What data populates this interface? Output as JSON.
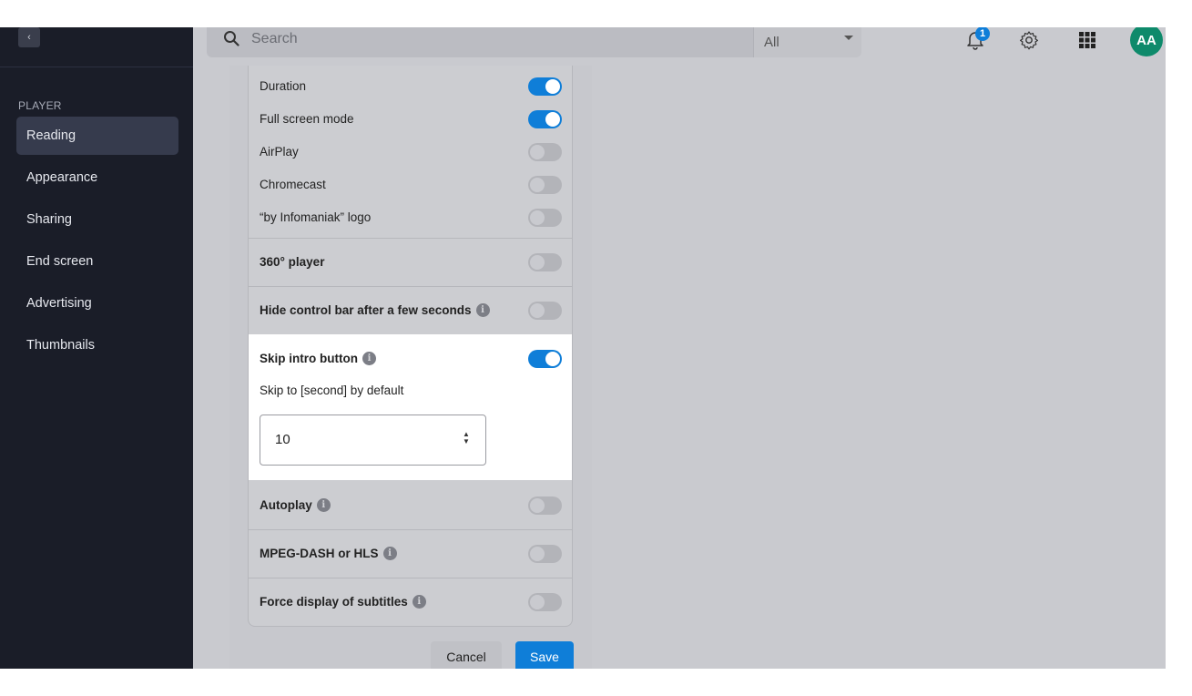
{
  "sidebar": {
    "collapse_glyph": "‹",
    "section_label": "PLAYER",
    "items": [
      {
        "label": "Reading",
        "active": true
      },
      {
        "label": "Appearance"
      },
      {
        "label": "Sharing"
      },
      {
        "label": "End screen"
      },
      {
        "label": "Advertising"
      },
      {
        "label": "Thumbnails"
      }
    ]
  },
  "topbar": {
    "search_placeholder": "Search",
    "scope_value": "All",
    "notification_count": "1",
    "avatar_initials": "AA"
  },
  "settings": {
    "rows": [
      {
        "label": "Duration",
        "enabled": true
      },
      {
        "label": "Full screen mode",
        "enabled": true
      },
      {
        "label": "AirPlay",
        "enabled": false
      },
      {
        "label": "Chromecast",
        "enabled": false
      },
      {
        "label": "“by Infomaniak” logo",
        "enabled": false
      },
      {
        "label": "360° player",
        "enabled": false
      },
      {
        "label": "Hide control bar after a few seconds",
        "enabled": false
      },
      {
        "label": "Skip intro button",
        "enabled": true
      },
      {
        "label": "Autoplay",
        "enabled": false
      },
      {
        "label": "MPEG-DASH or HLS",
        "enabled": false
      },
      {
        "label": "Force display of subtitles",
        "enabled": false
      }
    ],
    "skip_to_label": "Skip to [second] by default",
    "skip_to_value": "10",
    "info_glyph": "i"
  },
  "actions": {
    "cancel_label": "Cancel",
    "save_label": "Save"
  },
  "colors": {
    "accent": "#0f7ed8",
    "sidebar_bg": "#1a1d28",
    "avatar_bg": "#0e8a6b"
  },
  "icons": {
    "search": "search-icon",
    "notifications": "bell-icon",
    "settings": "gear-icon",
    "apps": "grid-icon"
  }
}
